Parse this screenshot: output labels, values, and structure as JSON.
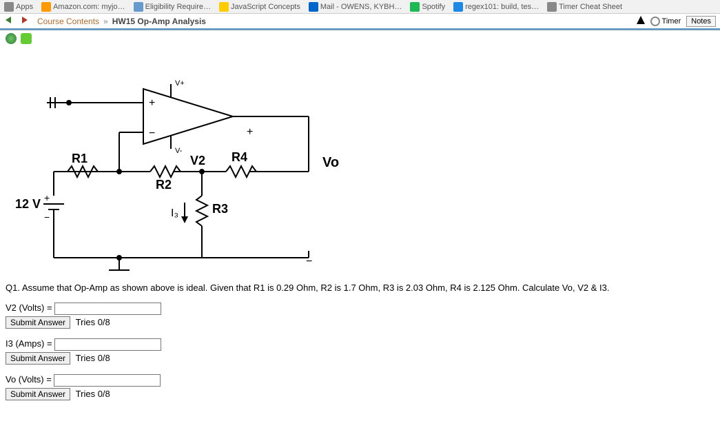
{
  "bookmarks": {
    "items": [
      {
        "label": "Apps"
      },
      {
        "label": "Amazon.com: myjo…"
      },
      {
        "label": "Eligibility Require…"
      },
      {
        "label": "JavaScript Concepts"
      },
      {
        "label": "Mail - OWENS, KYBH…"
      },
      {
        "label": "Spotify"
      },
      {
        "label": "regex101: build, tes…"
      },
      {
        "label": "Timer Cheat Sheet"
      }
    ]
  },
  "breadcrumb": {
    "link": "Course Contents",
    "sep": "»",
    "current": "HW15 Op-Amp Analysis",
    "timer_label": "Timer",
    "notes_label": "Notes"
  },
  "circuit": {
    "labels": {
      "vplus": "V+",
      "vminus": "V-",
      "plus_in": "+",
      "minus_in": "−",
      "out_plus": "+",
      "out_minus": "−",
      "r1": "R1",
      "r2": "R2",
      "r3": "R3",
      "r4": "R4",
      "v2": "V2",
      "i3": "I₃",
      "vo": "Vo",
      "source": "12 V",
      "src_plus": "+",
      "src_minus": "−"
    }
  },
  "question": "Q1. Assume that Op-Amp as shown above is ideal. Given that R1 is 0.29 Ohm, R2 is 1.7 Ohm, R3 is 2.03 Ohm, R4 is 2.125 Ohm. Calculate Vo, V2 & I3.",
  "answers": {
    "v2": {
      "label": "V2 (Volts) = ",
      "submit": "Submit Answer",
      "tries": "Tries 0/8"
    },
    "i3": {
      "label": "I3 (Amps) = ",
      "submit": "Submit Answer",
      "tries": "Tries 0/8"
    },
    "vo": {
      "label": "Vo (Volts) = ",
      "submit": "Submit Answer",
      "tries": "Tries 0/8"
    }
  }
}
